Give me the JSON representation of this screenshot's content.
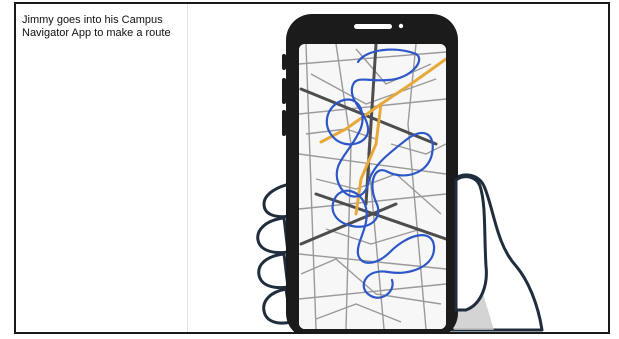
{
  "panel": {
    "caption": "Jimmy goes into his Campus\nNavigator App to make a route"
  },
  "colors": {
    "route": "#2d57c8",
    "highlight_road": "#e6a93a",
    "phone_body": "#1b1b1b",
    "hand_outline": "#1f2d3d",
    "hand_shadow": "#c9c9c9"
  },
  "icons": {
    "camera": "camera-dot-icon",
    "speaker": "speaker-slot-icon"
  }
}
